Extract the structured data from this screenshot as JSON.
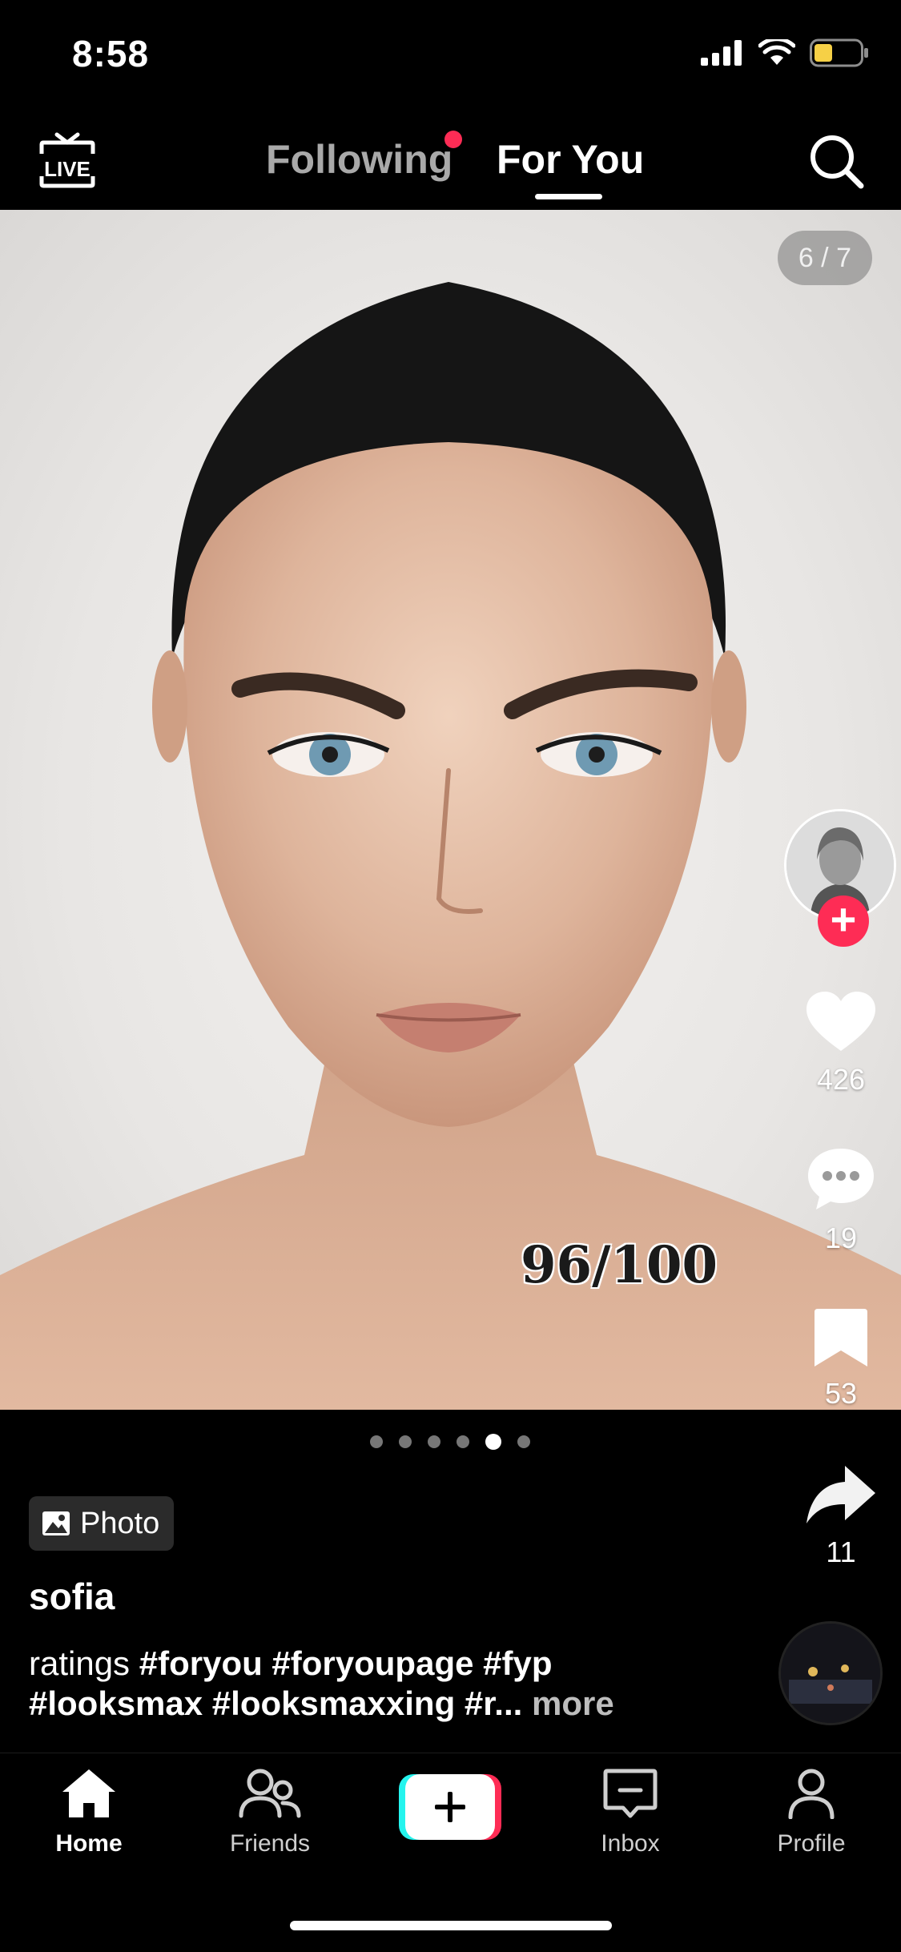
{
  "status_bar": {
    "time": "8:58"
  },
  "top_nav": {
    "live_label": "LIVE",
    "tabs": [
      {
        "label": "Following"
      },
      {
        "label": "For You"
      }
    ]
  },
  "post": {
    "photo_counter": "6 / 7",
    "overlay_text": "96/100",
    "carousel": {
      "count": 6,
      "active_index": 4
    },
    "type_badge": "Photo",
    "username": "sofia",
    "caption": {
      "prefix": "ratings",
      "hashtags_line1": "#foryou #foryoupage #fyp",
      "hashtags_line2": "#looksmax #looksmaxxing #r...",
      "more": "more"
    }
  },
  "actions": {
    "likes": "426",
    "comments": "19",
    "saves": "53",
    "shares": "11"
  },
  "bottom_nav": {
    "items": [
      {
        "label": "Home"
      },
      {
        "label": "Friends"
      },
      {
        "label": "Inbox"
      },
      {
        "label": "Profile"
      }
    ]
  },
  "colors": {
    "accent": "#fe2c55",
    "cyan": "#25f4ee",
    "background": "#000000"
  }
}
